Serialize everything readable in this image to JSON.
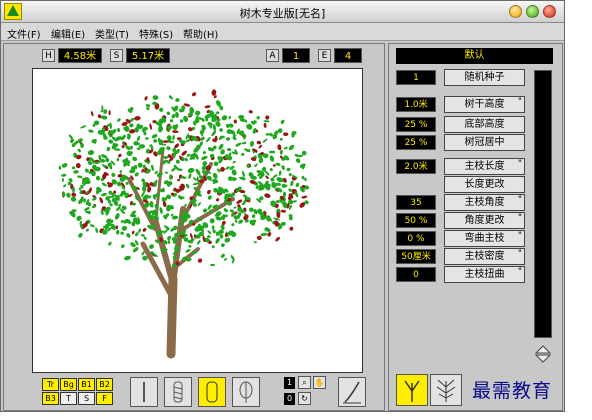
{
  "window": {
    "title": "树木专业版[无名]"
  },
  "menu": [
    "文件(F)",
    "编辑(E)",
    "类型(T)",
    "特殊(S)",
    "帮助(H)"
  ],
  "readouts": {
    "h_label": "H",
    "h_value": "4.58米",
    "s_label": "S",
    "s_value": "5.17米",
    "a_label": "A",
    "a_value": "1",
    "e_label": "E",
    "e_value": "4"
  },
  "bottom_left": {
    "row1": [
      "Tr",
      "Bg",
      "B1",
      "B2"
    ],
    "row2": [
      "B3",
      "T",
      "S",
      "F"
    ],
    "num1": "1",
    "num2": "0"
  },
  "right": {
    "preset": "默认",
    "random_seed_value": "1",
    "random_seed_label": "随机种子",
    "params": [
      {
        "value": "1.0米",
        "label": "树干高度",
        "mark": "\""
      },
      {
        "value": "25 %",
        "label": "底部高度",
        "mark": ""
      },
      {
        "value": "25 %",
        "label": "树冠居中",
        "mark": ""
      },
      {
        "value": "2.0米",
        "label": "主枝长度",
        "mark": "\""
      },
      {
        "value": "",
        "label": "长度更改",
        "mark": ""
      },
      {
        "value": "35",
        "label": "主枝角度",
        "mark": "\""
      },
      {
        "value": "50 %",
        "label": "角度更改",
        "mark": "\""
      },
      {
        "value": "0 %",
        "label": "弯曲主枝",
        "mark": "\""
      },
      {
        "value": "50厘米",
        "label": "主枝密度",
        "mark": "\""
      },
      {
        "value": "0",
        "label": "主枝扭曲",
        "mark": "\""
      }
    ]
  },
  "watermark": "最需教育",
  "colors": {
    "accent": "#ffee00",
    "display_bg": "#000000",
    "display_text": "#ffea00",
    "leaf": "#1fa81f",
    "berry": "#9a1515",
    "trunk": "#8b6a4a"
  }
}
